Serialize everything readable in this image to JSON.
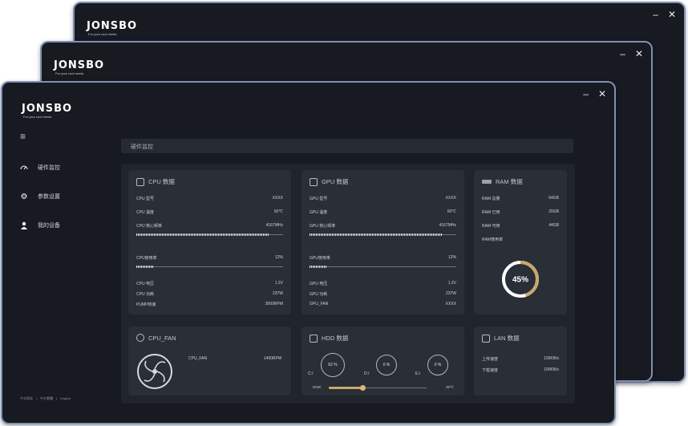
{
  "app": {
    "logo": "JONSBO",
    "tagline": "For your cool needs",
    "controls": {
      "minimize": "–",
      "close": "✕"
    }
  },
  "sidebar": {
    "items": [
      {
        "label": "硬件监控",
        "icon": "speedometer-icon"
      },
      {
        "label": "参数设置",
        "icon": "gear-icon"
      },
      {
        "label": "我的设备",
        "icon": "user-icon"
      }
    ],
    "footer": [
      "中文简体",
      "中文繁體",
      "English"
    ]
  },
  "header": {
    "title": "硬件监控"
  },
  "cpu": {
    "title": "CPU 数据",
    "model_label": "CPU 型号",
    "model_value": "XXXX",
    "temp_label": "CPU 温度",
    "temp_value": "60℃",
    "freq_label": "CPU 核心频率",
    "freq_value": "4167MHz",
    "freq_fill": 0.9,
    "usage_label": "CPU使用率",
    "usage_value": "12%",
    "usage_fill": 0.12,
    "voltage_label": "CPU 电压",
    "voltage_value": "1.2V",
    "power_label": "CPU 功耗",
    "power_value": "237W",
    "pump_label": "PUMP转速",
    "pump_value": "3000RPM"
  },
  "gpu": {
    "title": "GPU 数据",
    "model_label": "GPU 型号",
    "model_value": "XXXX",
    "temp_label": "GPU 温度",
    "temp_value": "60℃",
    "freq_label": "GPU 核心频率",
    "freq_value": "4167MHz",
    "freq_fill": 0.9,
    "usage_label": "GPU使用率",
    "usage_value": "12%",
    "usage_fill": 0.12,
    "voltage_label": "GPU 电压",
    "voltage_value": "1.2V",
    "power_label": "GPU 功耗",
    "power_value": "237W",
    "fan_label": "GPU_FAN",
    "fan_value": "XXXX"
  },
  "ram": {
    "title": "RAM 数据",
    "total_label": "RAM 总量",
    "total_value": "64GB",
    "used_label": "RAM 已用",
    "used_value": "20GB",
    "available_label": "RAM 可用",
    "available_value": "44GB",
    "usage_label": "RAM使用率",
    "usage_value": "45%",
    "usage_fraction": 0.45,
    "ring_color": "#c8a86b"
  },
  "cpu_fan": {
    "title": "CPU_FAN",
    "fan_label": "CPU_FAN",
    "fan_value": "1400RPM"
  },
  "hdd": {
    "title": "HDD 数据",
    "drives": [
      {
        "label": "C:/",
        "value": "62 %"
      },
      {
        "label": "D:/",
        "value": "0 %"
      },
      {
        "label": "E:/",
        "value": "0 %"
      }
    ],
    "disk_label": "DISK",
    "disk_value": "49℃",
    "disk_fill": 0.35
  },
  "lan": {
    "title": "LAN 数据",
    "up_label": "上传速度",
    "up_value": "100KB/s",
    "down_label": "下载速度",
    "down_value": "100KB/s"
  }
}
